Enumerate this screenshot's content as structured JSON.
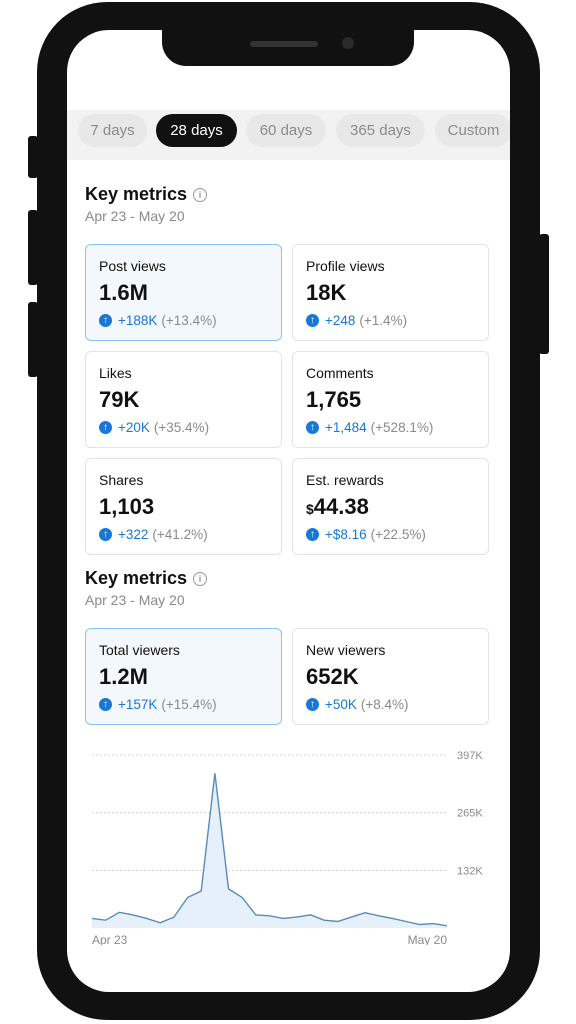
{
  "tabs": [
    {
      "label": "7 days",
      "active": false
    },
    {
      "label": "28 days",
      "active": true
    },
    {
      "label": "60 days",
      "active": false
    },
    {
      "label": "365 days",
      "active": false
    },
    {
      "label": "Custom",
      "active": false
    }
  ],
  "section1": {
    "title": "Key metrics",
    "date_range": "Apr 23 - May 20",
    "cards": [
      {
        "label": "Post views",
        "value": "1.6M",
        "delta": "+188K",
        "pct": "(+13.4%)",
        "selected": true
      },
      {
        "label": "Profile views",
        "value": "18K",
        "delta": "+248",
        "pct": "(+1.4%)",
        "selected": false
      },
      {
        "label": "Likes",
        "value": "79K",
        "delta": "+20K",
        "pct": "(+35.4%)",
        "selected": false
      },
      {
        "label": "Comments",
        "value": "1,765",
        "delta": "+1,484",
        "pct": "(+528.1%)",
        "selected": false
      },
      {
        "label": "Shares",
        "value": "1,103",
        "delta": "+322",
        "pct": "(+41.2%)",
        "selected": false
      },
      {
        "label": "Est. rewards",
        "currency": "$",
        "value": "44.38",
        "delta": "+$8.16",
        "pct": "(+22.5%)",
        "selected": false
      }
    ]
  },
  "section2": {
    "title": "Key metrics",
    "date_range": "Apr 23 - May 20",
    "cards": [
      {
        "label": "Total viewers",
        "value": "1.2M",
        "delta": "+157K",
        "pct": "(+15.4%)",
        "selected": true
      },
      {
        "label": "New viewers",
        "value": "652K",
        "delta": "+50K",
        "pct": "(+8.4%)",
        "selected": false
      }
    ]
  },
  "colors": {
    "accent": "#1878d6",
    "selected_bg": "#f3f8fc",
    "selected_border": "#8ec3ec"
  },
  "chart_data": {
    "type": "area",
    "x_labels": [
      "Apr 23",
      "May 20"
    ],
    "y_ticks": [
      "397K",
      "265K",
      "132K"
    ],
    "ylim": [
      0,
      397
    ],
    "grid": true,
    "values": [
      22,
      18,
      36,
      30,
      22,
      12,
      25,
      70,
      85,
      355,
      90,
      70,
      30,
      28,
      22,
      25,
      30,
      18,
      15,
      25,
      35,
      28,
      22,
      15,
      8,
      10,
      5
    ]
  }
}
